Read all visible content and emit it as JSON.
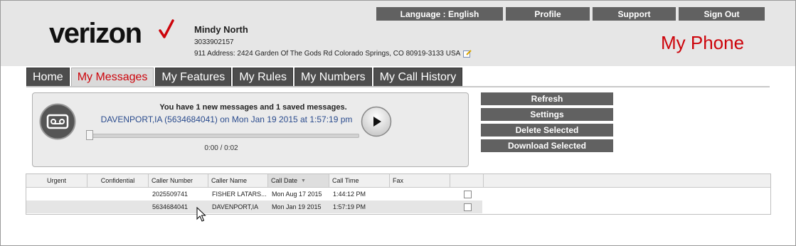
{
  "header": {
    "logo_text": "verizon",
    "app_title": "My Phone",
    "top_links": [
      "Language : English",
      "Profile",
      "Support",
      "Sign Out"
    ],
    "user": {
      "name": "Mindy North",
      "phone": "3033902157",
      "address": "911 Address: 2424 Garden Of The Gods Rd Colorado Springs, CO 80919-3133 USA"
    }
  },
  "tabs": [
    "Home",
    "My Messages",
    "My Features",
    "My Rules",
    "My Numbers",
    "My Call History"
  ],
  "active_tab": "My Messages",
  "player": {
    "summary": "You have 1 new messages and 1 saved messages.",
    "current_message": "DAVENPORT,IA (5634684041) on Mon Jan 19 2015 at 1:57:19 pm",
    "time": "0:00 / 0:02",
    "progress": 0
  },
  "actions": [
    "Refresh",
    "Settings",
    "Delete Selected",
    "Download Selected"
  ],
  "table": {
    "columns": [
      "Urgent",
      "Confidential",
      "Caller Number",
      "Caller Name",
      "Call Date",
      "Call Time",
      "Fax",
      ""
    ],
    "sorted_column": "Call Date",
    "rows": [
      {
        "urgent": "",
        "confidential": "",
        "number": "2025509741",
        "name": "FISHER LATARS...",
        "date": "Mon Aug 17 2015",
        "time": "1:44:12 PM",
        "fax": "",
        "selected": false
      },
      {
        "urgent": "",
        "confidential": "",
        "number": "5634684041",
        "name": "DAVENPORT,IA",
        "date": "Mon Jan 19 2015",
        "time": "1:57:19 PM",
        "fax": "",
        "selected": false
      }
    ]
  },
  "colors": {
    "brand_red": "#cd040b",
    "button_gray": "#616161",
    "header_bg": "#e6e6e6",
    "link_blue": "#2a4b8d"
  }
}
